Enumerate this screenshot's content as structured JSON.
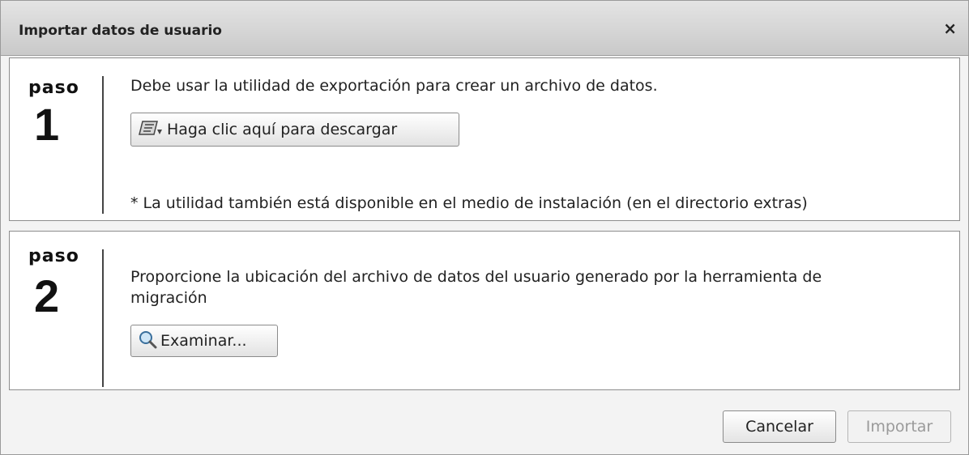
{
  "dialog": {
    "title": "Importar datos de usuario",
    "close_label": "×"
  },
  "step1": {
    "word": "paso",
    "number": "1",
    "instruction": "Debe usar la utilidad de exportación para crear un archivo de datos.",
    "download_button": "Haga clic aquí para descargar",
    "download_icon": "download-tool-icon",
    "note": "* La utilidad también está disponible en el medio de instalación (en el directorio extras)"
  },
  "step2": {
    "word": "paso",
    "number": "2",
    "instruction_line1": "Proporcione la ubicación del archivo de datos del usuario generado por la herramienta de",
    "instruction_line2": "migración",
    "browse_button": "Examinar...",
    "browse_icon": "magnifier-icon"
  },
  "footer": {
    "cancel_label": "Cancelar",
    "import_label": "Importar",
    "import_enabled": false
  }
}
